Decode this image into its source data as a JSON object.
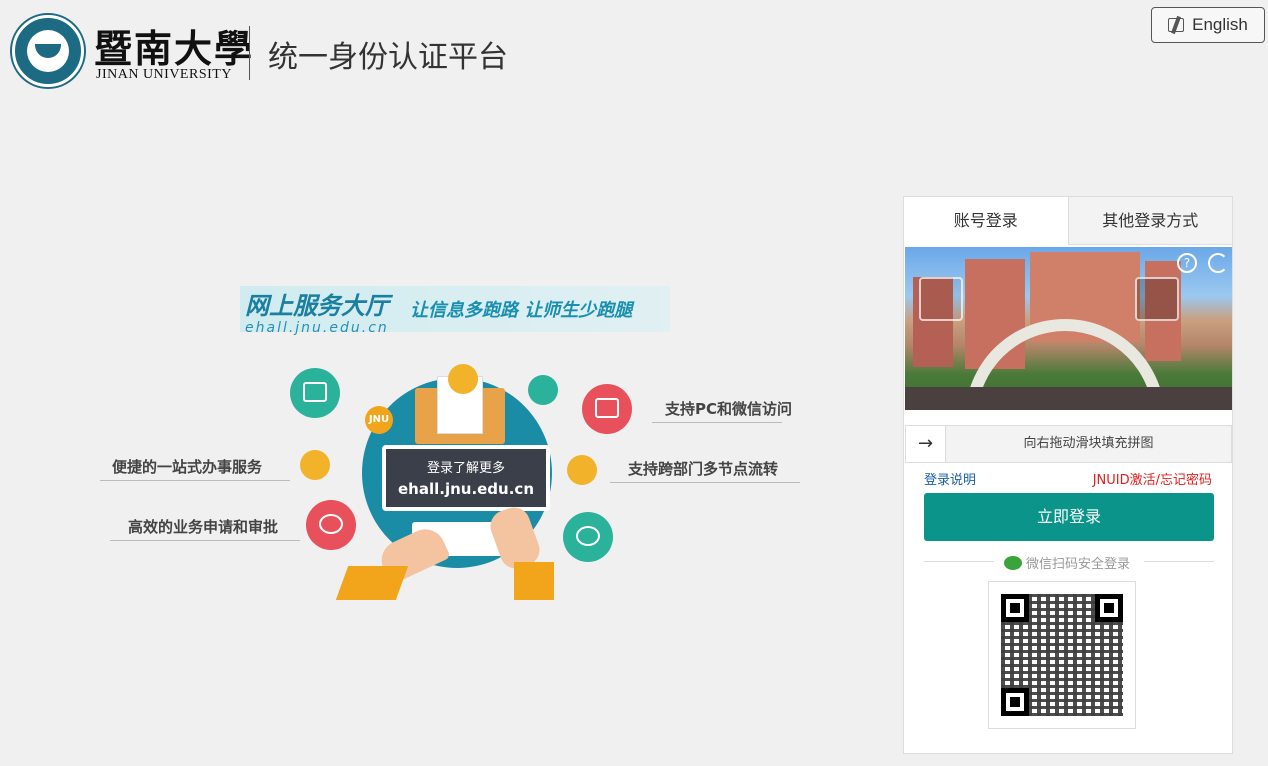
{
  "header": {
    "logo_cn": "暨南大學",
    "logo_en": "JINAN UNIVERSITY",
    "platform_title": "统一身份认证平台",
    "lang_button": "English"
  },
  "illustration": {
    "banner_title": "网上服务大厅",
    "banner_slogan": "让信息多跑路  让师生少跑腿",
    "banner_url": "ehall.jnu.edu.cn",
    "screen_line1": "登录了解更多",
    "screen_line2": "ehall.jnu.edu.cn",
    "badge": "JNU",
    "features": {
      "pc_wechat": "支持PC和微信访问",
      "one_stop": "便捷的一站式办事服务",
      "cross_dept": "支持跨部门多节点流转",
      "efficient": "高效的业务申请和审批"
    }
  },
  "login": {
    "tabs": [
      "账号登录",
      "其他登录方式"
    ],
    "captcha_help": "?",
    "captcha_refresh": "↻",
    "slider_handle": "→",
    "slider_text": "向右拖动滑块填充拼图",
    "help_link": "登录说明",
    "forgot_link": "JNUID激活/忘记密码",
    "login_button": "立即登录",
    "wechat_label": "微信扫码安全登录"
  },
  "colors": {
    "primary": "#0a948a",
    "link": "#1a5fa8",
    "warning": "#e02020"
  }
}
